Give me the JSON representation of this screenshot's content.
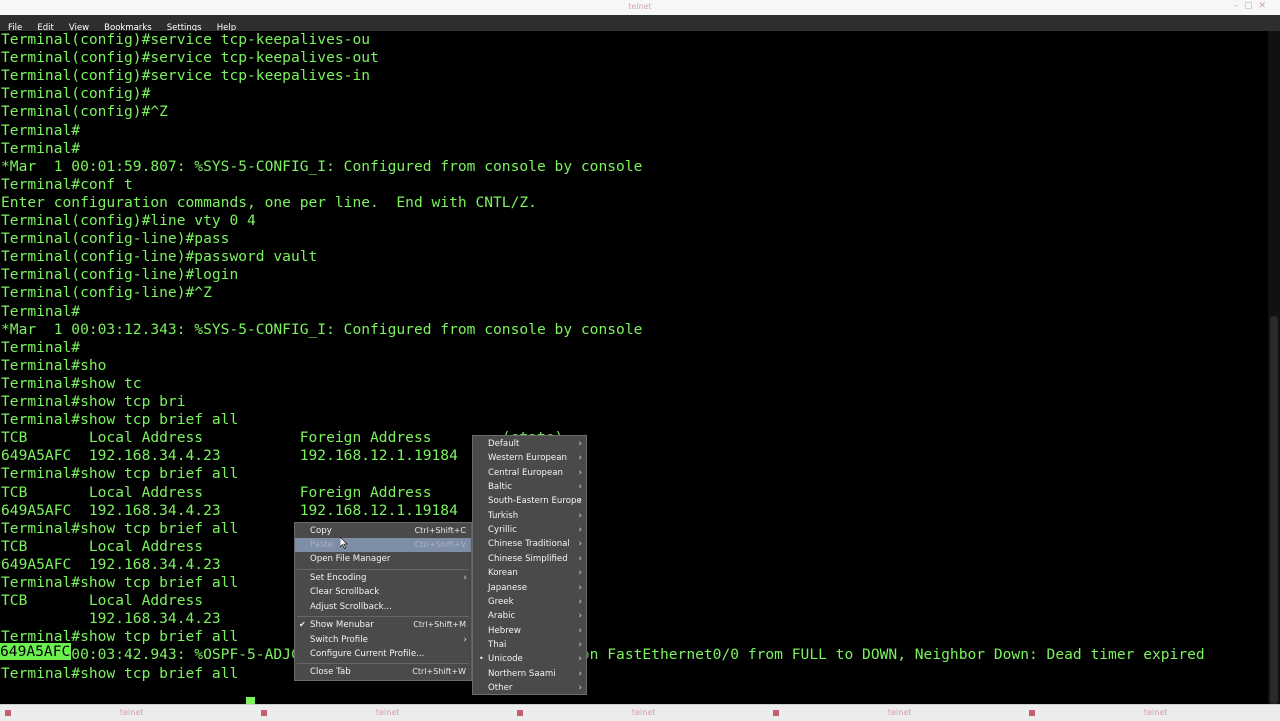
{
  "window": {
    "title": "telnet"
  },
  "menubar": {
    "items": [
      "File",
      "Edit",
      "View",
      "Bookmarks",
      "Settings",
      "Help"
    ]
  },
  "terminal": {
    "lines": [
      "Terminal(config)#service tcp-keepalives-ou",
      "Terminal(config)#service tcp-keepalives-out",
      "Terminal(config)#service tcp-keepalives-in",
      "Terminal(config)#",
      "Terminal(config)#^Z",
      "Terminal#",
      "Terminal#",
      "*Mar  1 00:01:59.807: %SYS-5-CONFIG_I: Configured from console by console",
      "Terminal#conf t",
      "Enter configuration commands, one per line.  End with CNTL/Z.",
      "Terminal(config)#line vty 0 4",
      "Terminal(config-line)#pass",
      "Terminal(config-line)#password vault",
      "Terminal(config-line)#login",
      "Terminal(config-line)#^Z",
      "Terminal#",
      "*Mar  1 00:03:12.343: %SYS-5-CONFIG_I: Configured from console by console",
      "Terminal#",
      "Terminal#sho",
      "Terminal#show tc",
      "Terminal#show tcp bri",
      "Terminal#show tcp brief all",
      "TCB       Local Address           Foreign Address        (state)",
      "649A5AFC  192.168.34.4.23         192.168.12.1.19184     ESTAB",
      "Terminal#show tcp brief all",
      "TCB       Local Address           Foreign Address",
      "649A5AFC  192.168.34.4.23         192.168.12.1.19184",
      "Terminal#show tcp brief all",
      "TCB       Local Address",
      "649A5AFC  192.168.34.4.23",
      "Terminal#show tcp brief all",
      "TCB       Local Address",
      "          192.168.34.4.23",
      "Terminal#show tcp brief all",
      "*Mar  1 00:03:42.943: %OSPF-5-ADJCHG: Process 1, Nbr 192.168.12.1 on FastEthernet0/0 from FULL to DOWN, Neighbor Down: Dead timer expired",
      "Terminal#show tcp brief all "
    ],
    "selected_text": "649A5AFC"
  },
  "context_menu": {
    "items": [
      {
        "label": "Copy",
        "shortcut": "Ctrl+Shift+C"
      },
      {
        "label": "Paste",
        "shortcut": "Ctrl+Shift+V"
      },
      {
        "label": "Open File Manager",
        "shortcut": ""
      },
      {
        "label": "Set Encoding",
        "shortcut": ""
      },
      {
        "label": "Clear Scrollback",
        "shortcut": ""
      },
      {
        "label": "Adjust Scrollback...",
        "shortcut": ""
      },
      {
        "label": "Show Menubar",
        "shortcut": "Ctrl+Shift+M"
      },
      {
        "label": "Switch Profile",
        "shortcut": ""
      },
      {
        "label": "Configure Current Profile...",
        "shortcut": ""
      },
      {
        "label": "Close Tab",
        "shortcut": "Ctrl+Shift+W"
      }
    ]
  },
  "encoding_menu": {
    "items": [
      "Default",
      "Western European",
      "Central European",
      "Baltic",
      "South-Eastern Europe",
      "Turkish",
      "Cyrillic",
      "Chinese Traditional",
      "Chinese Simplified",
      "Korean",
      "Japanese",
      "Greek",
      "Arabic",
      "Hebrew",
      "Thai",
      "Unicode",
      "Northern Saami",
      "Other"
    ],
    "selected": "Unicode"
  },
  "tabs": [
    "telnet",
    "telnet",
    "telnet",
    "telnet",
    "telnet"
  ],
  "colors": {
    "terminal_fg": "#7cf25f",
    "terminal_bg": "#000000",
    "menu_bg": "#4a4a4a",
    "menu_hover": "#7e8ea6"
  },
  "icons": {
    "menu_check": "check-icon",
    "submenu": "chevron-right-icon",
    "radio": "bullet-icon"
  }
}
